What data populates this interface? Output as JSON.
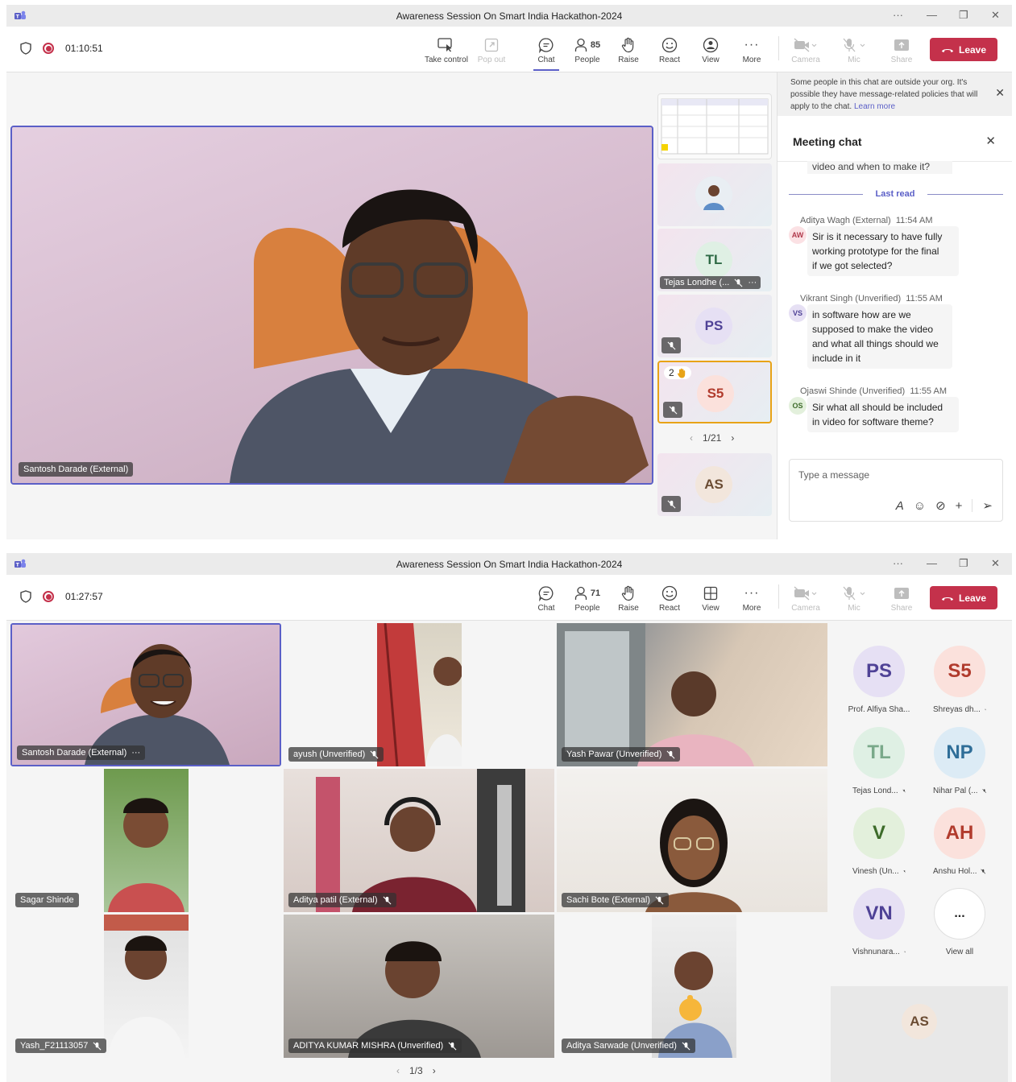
{
  "meeting_title": "Awareness Session On Smart India Hackathon-2024",
  "colors": {
    "accent": "#5b5fc7",
    "leave": "#c4314b",
    "raised_hand": "#e8a317"
  },
  "panel1": {
    "timer": "01:10:51",
    "toolbar": {
      "take_control": "Take control",
      "pop_out": "Pop out",
      "chat": "Chat",
      "people": "People",
      "people_count": "85",
      "raise": "Raise",
      "react": "React",
      "view": "View",
      "more": "More",
      "camera": "Camera",
      "mic": "Mic",
      "share": "Share",
      "leave": "Leave"
    },
    "main_speaker": "Santosh Darade (External)",
    "side_tiles": [
      {
        "initials": "TL",
        "name": "Tejas Londhe (..."
      },
      {
        "initials": "PS"
      },
      {
        "initials": "S5",
        "raised_hand_order": "2"
      },
      {
        "initials": "AS"
      }
    ],
    "pager": "1/21",
    "chat": {
      "notice": "Some people in this chat are outside your org. It's possible they have message-related policies that will apply to the chat.",
      "notice_link": "Learn more",
      "title": "Meeting chat",
      "prev_tail": "video and when to make it?",
      "last_read": "Last read",
      "messages": [
        {
          "author": "Aditya Wagh (External)",
          "time": "11:54 AM",
          "initials": "AW",
          "lines": [
            "Sir is it necessary to have fully",
            "working prototype for the final",
            "if we got selected?"
          ]
        },
        {
          "author": "Vikrant Singh (Unverified)",
          "time": "11:55 AM",
          "initials": "VS",
          "lines": [
            "in software how are we",
            "supposed to make the video",
            "and what all things should we",
            "include in it"
          ]
        },
        {
          "author": "Ojaswi Shinde (Unverified)",
          "time": "11:55 AM",
          "initials": "OS",
          "lines": [
            "Sir what all should be included",
            "in video for software theme?"
          ]
        }
      ],
      "composer_placeholder": "Type a message"
    }
  },
  "panel2": {
    "timer": "01:27:57",
    "toolbar": {
      "chat": "Chat",
      "people": "People",
      "people_count": "71",
      "raise": "Raise",
      "react": "React",
      "view": "View",
      "more": "More",
      "camera": "Camera",
      "mic": "Mic",
      "share": "Share",
      "leave": "Leave"
    },
    "video_tiles": [
      {
        "name": "Santosh Darade (External)"
      },
      {
        "name": "ayush (Unverified)"
      },
      {
        "name": "Yash Pawar (Unverified)"
      },
      {
        "name": "Sagar Shinde"
      },
      {
        "name": "Aditya patil (External)"
      },
      {
        "name": "Sachi Bote (External)"
      },
      {
        "name": "Yash_F21113057"
      },
      {
        "name": "ADITYA KUMAR MISHRA (Unverified)"
      },
      {
        "name": "Aditya Sarwade (Unverified)"
      }
    ],
    "roster": [
      {
        "initials": "PS",
        "name": "Prof. Alfiya Sha..."
      },
      {
        "initials": "S5",
        "name": "Shreyas dh..."
      },
      {
        "initials": "TL",
        "name": "Tejas Lond..."
      },
      {
        "initials": "NP",
        "name": "Nihar Pal (..."
      },
      {
        "initials": "V",
        "name": "Vinesh (Un..."
      },
      {
        "initials": "AH",
        "name": "Anshu Hol..."
      },
      {
        "initials": "VN",
        "name": "Vishnunara..."
      },
      {
        "initials": "...",
        "name": "View all"
      }
    ],
    "self_tile_initials": "AS",
    "pager": "1/3"
  }
}
